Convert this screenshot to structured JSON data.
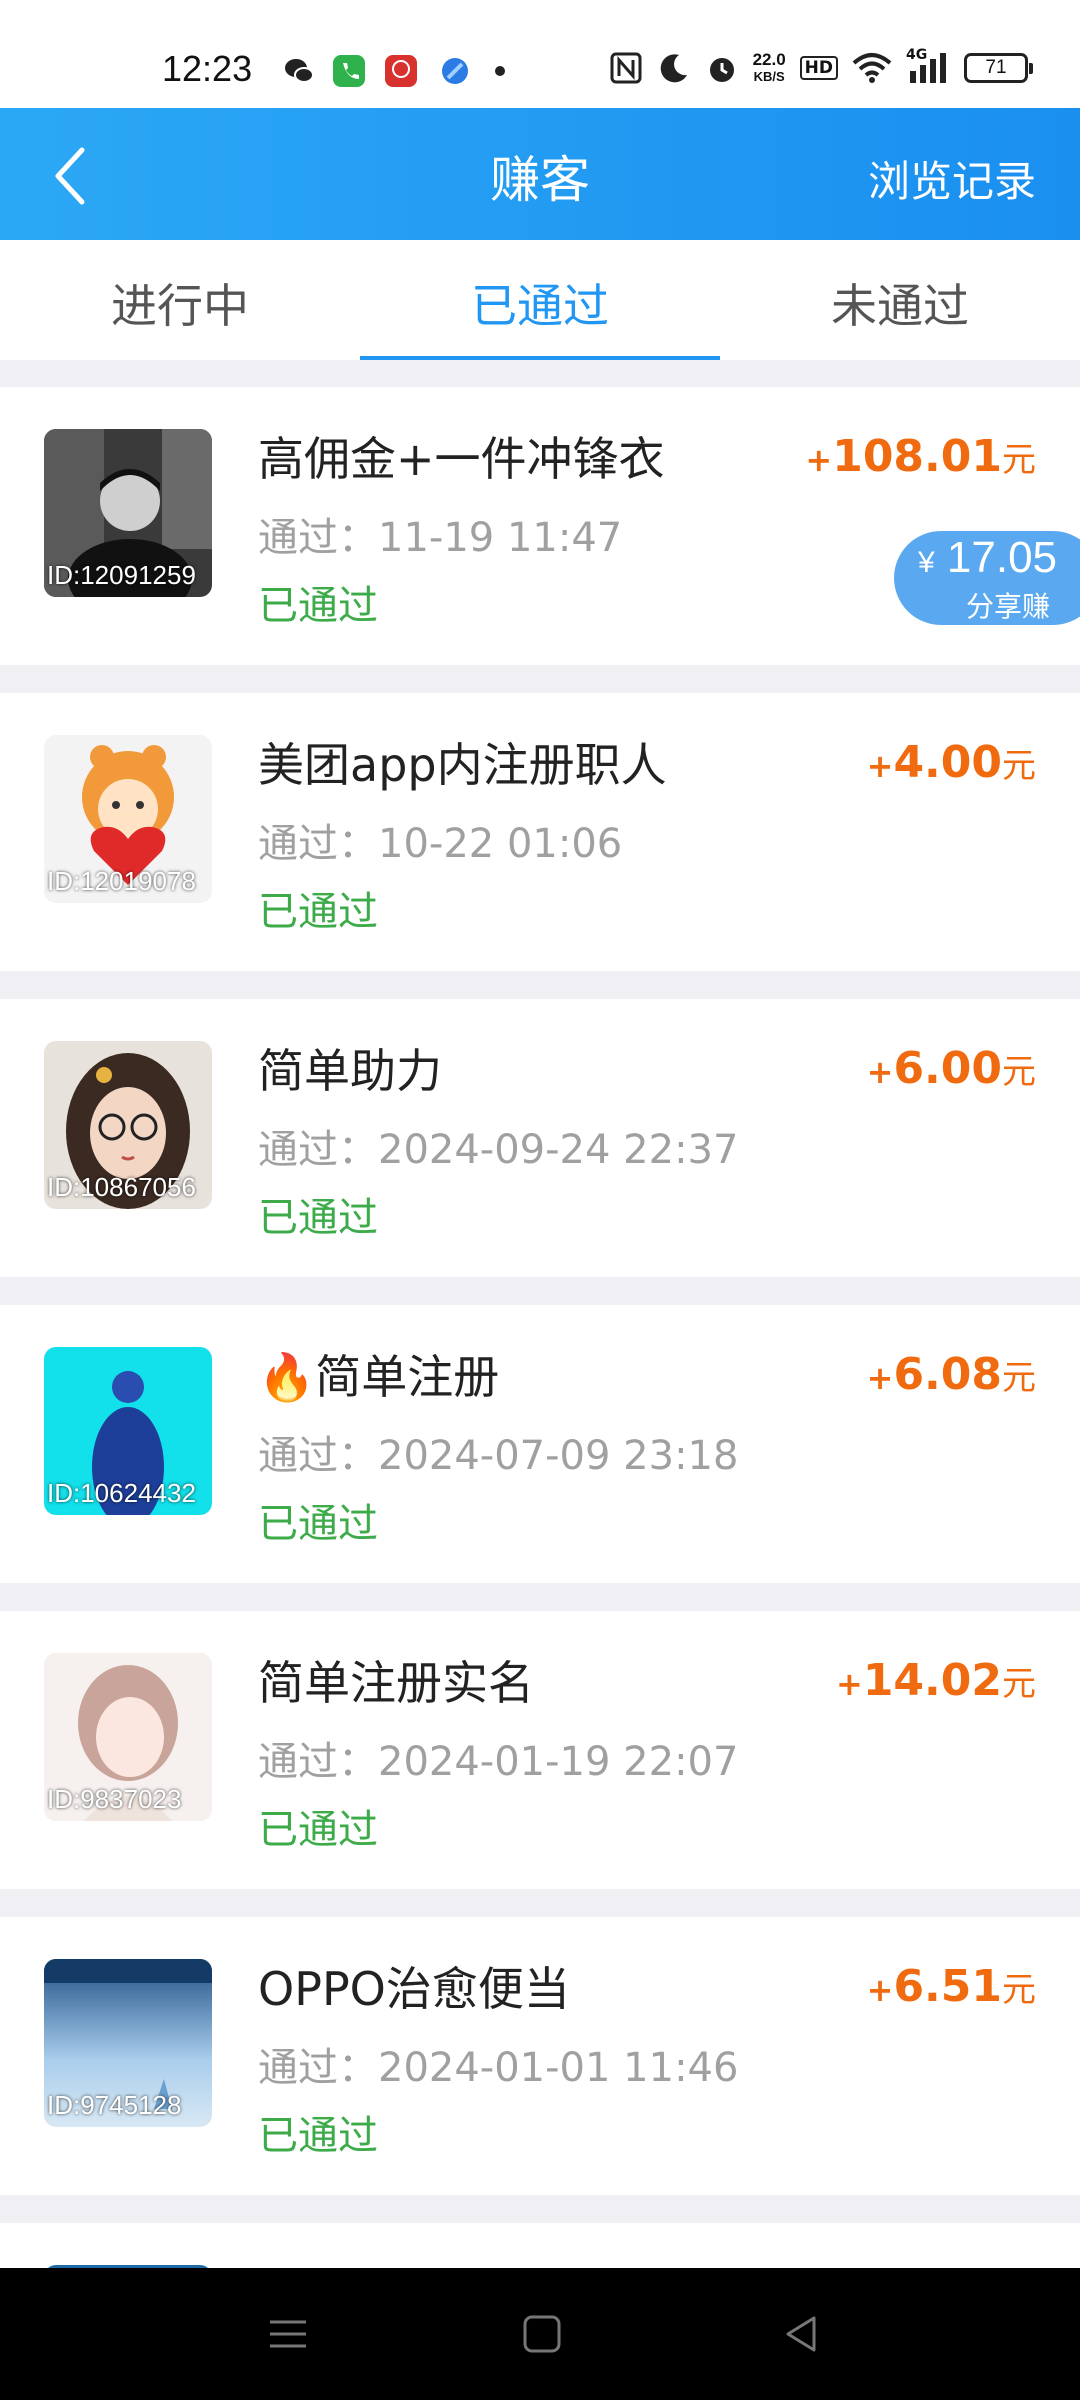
{
  "status_bar": {
    "time": "12:23",
    "net_speed_value": "22.0",
    "net_speed_unit": "KB/S",
    "hd": "HD",
    "network": "4G",
    "battery": "71",
    "icons": [
      "wechat-icon",
      "phone-icon",
      "app-icon",
      "browser-icon",
      "dot-icon",
      "nfc-icon",
      "moon-icon",
      "alarm-icon",
      "wifi-icon",
      "signal-icon"
    ]
  },
  "header": {
    "title": "赚客",
    "right_link": "浏览记录"
  },
  "tabs": [
    {
      "label": "进行中",
      "active": false
    },
    {
      "label": "已通过",
      "active": true
    },
    {
      "label": "未通过",
      "active": false
    }
  ],
  "tasks": [
    {
      "id_label": "ID:12091259",
      "title": "高佣金+一件冲锋衣",
      "pass_time": "通过：11-19 11:47",
      "status": "已通过",
      "plus": "+",
      "amount": "108.01",
      "unit": "元",
      "share": {
        "currency": "¥",
        "amount": "17.05",
        "label": "分享赚"
      }
    },
    {
      "id_label": "ID:12019078",
      "title": "美团app内注册职人",
      "pass_time": "通过：10-22 01:06",
      "status": "已通过",
      "plus": "+",
      "amount": "4.00",
      "unit": "元"
    },
    {
      "id_label": "ID:10867056",
      "title": "简单助力",
      "pass_time": "通过：2024-09-24 22:37",
      "status": "已通过",
      "plus": "+",
      "amount": "6.00",
      "unit": "元"
    },
    {
      "id_label": "ID:10624432",
      "title": "🔥简单注册",
      "pass_time": "通过：2024-07-09 23:18",
      "status": "已通过",
      "plus": "+",
      "amount": "6.08",
      "unit": "元"
    },
    {
      "id_label": "ID:9837023",
      "title": "简单注册实名",
      "pass_time": "通过：2024-01-19 22:07",
      "status": "已通过",
      "plus": "+",
      "amount": "14.02",
      "unit": "元"
    },
    {
      "id_label": "ID:9745128",
      "title": "OPPO治愈便当",
      "pass_time": "通过：2024-01-01 11:46",
      "status": "已通过",
      "plus": "+",
      "amount": "6.51",
      "unit": "元"
    }
  ],
  "colors": {
    "header_blue": "#1a8ff0",
    "active_tab": "#2196f3",
    "amount_orange": "#f06a10",
    "status_green": "#3dab4a"
  }
}
